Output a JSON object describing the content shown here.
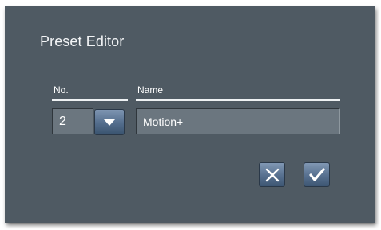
{
  "dialog": {
    "title": "Preset Editor",
    "no_label": "No.",
    "name_label": "Name",
    "no_value": "2",
    "name_value": "Motion+"
  },
  "icons": {
    "dropdown": "chevron-down-icon",
    "cancel": "close-icon",
    "ok": "checkmark-icon"
  },
  "colors": {
    "panel": "#4f5a63",
    "field": "#6b767f",
    "button": "#5a7392"
  }
}
